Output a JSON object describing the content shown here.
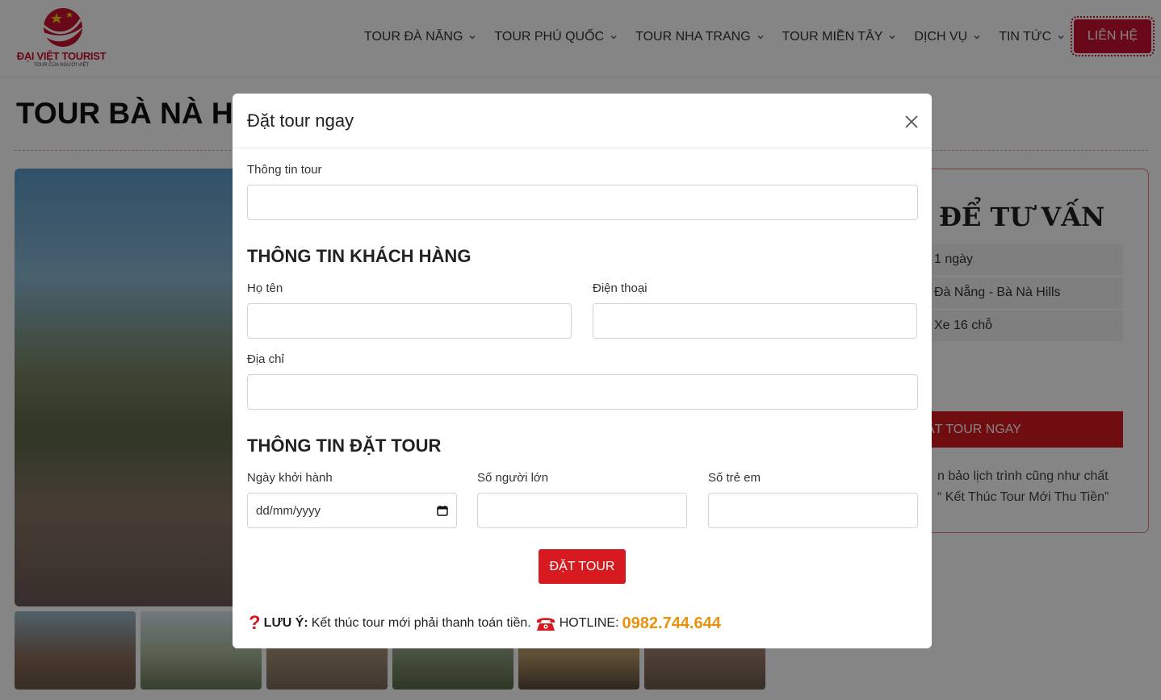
{
  "header": {
    "logo_title": "ĐẠI VIỆT TOURIST",
    "logo_sub": "TOUR CỦA NGƯỜI VIỆT",
    "nav": [
      {
        "label": "TOUR ĐÀ NẴNG"
      },
      {
        "label": "TOUR PHÚ QUỐC"
      },
      {
        "label": "TOUR NHA TRANG"
      },
      {
        "label": "TOUR MIỀN TÂY"
      },
      {
        "label": "DỊCH VỤ"
      },
      {
        "label": "TIN TỨC"
      }
    ],
    "contact_label": "LIÊN HỆ"
  },
  "page": {
    "title": "TOUR BÀ NÀ HIL",
    "sidebar": {
      "heading": "ĐỂ TƯ VẤN",
      "rows": [
        "1 ngày",
        "Đà Nẵng - Bà Nà Hills",
        "Xe 16 chỗ"
      ],
      "button": "ẶT TOUR NGAY",
      "note_line1": "n bảo lịch trình cũng như chất",
      "note_line2": "“ Kết Thúc Tour Mới Thu Tiền”"
    }
  },
  "modal": {
    "title": "Đặt tour ngay",
    "tour_info_label": "Thông tin tour",
    "tour_info_value": "",
    "customer_section": "THÔNG TIN KHÁCH HÀNG",
    "name_label": "Họ tên",
    "phone_label": "Điện thoại",
    "address_label": "Địa chỉ",
    "booking_section": "THÔNG TIN ĐẶT TOUR",
    "date_label": "Ngày khởi hành",
    "date_placeholder": "dd/mm/yyyy",
    "adults_label": "Số người lớn",
    "children_label": "Số trẻ em",
    "submit_label": "ĐẶT TOUR",
    "note_prefix": "LƯU Ý:",
    "note_text": "Kết thúc tour mới phải thanh toán tiền.",
    "hotline_label": "HOTLINE:",
    "hotline_number": "0982.744.644"
  },
  "colors": {
    "brand_red": "#d71920",
    "hotline_orange": "#e8920c"
  },
  "icons": [
    "logo-mark-icon",
    "chevron-down-icon",
    "close-icon",
    "calendar-icon",
    "question-icon",
    "phone-icon"
  ]
}
